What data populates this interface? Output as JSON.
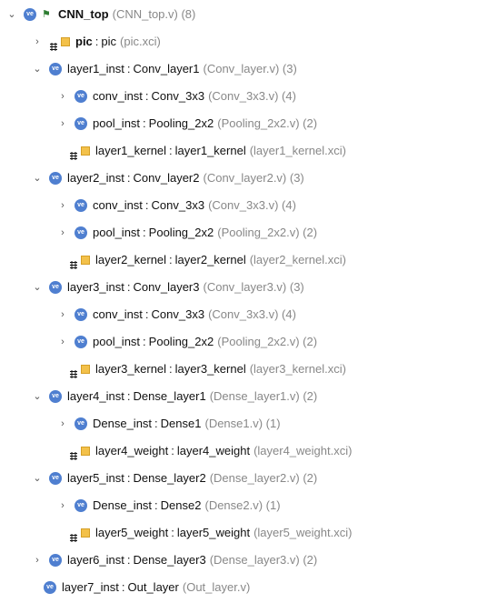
{
  "tree": {
    "rows": [
      {
        "expand": "expanded",
        "icon": "verilog-module-icon",
        "secondary_icon": "hierarchy-icon",
        "instance": "CNN_top",
        "module": "",
        "meta": "(CNN_top.v) (8)"
      },
      {
        "expand": "collapsed",
        "icon": "ip-core-icon",
        "instance": "pic",
        "module": "pic",
        "meta": "(pic.xci)"
      },
      {
        "expand": "expanded",
        "icon": "verilog-module-icon",
        "instance": "layer1_inst",
        "module": "Conv_layer1",
        "meta": "(Conv_layer.v) (3)"
      },
      {
        "expand": "collapsed",
        "icon": "verilog-module-icon",
        "instance": "conv_inst",
        "module": "Conv_3x3",
        "meta": "(Conv_3x3.v) (4)"
      },
      {
        "expand": "collapsed",
        "icon": "verilog-module-icon",
        "instance": "pool_inst",
        "module": "Pooling_2x2",
        "meta": "(Pooling_2x2.v) (2)"
      },
      {
        "expand": "none",
        "icon": "ip-core-icon",
        "instance": "layer1_kernel",
        "module": "layer1_kernel",
        "meta": "(layer1_kernel.xci)"
      },
      {
        "expand": "expanded",
        "icon": "verilog-module-icon",
        "instance": "layer2_inst",
        "module": "Conv_layer2",
        "meta": "(Conv_layer2.v) (3)"
      },
      {
        "expand": "collapsed",
        "icon": "verilog-module-icon",
        "instance": "conv_inst",
        "module": "Conv_3x3",
        "meta": "(Conv_3x3.v) (4)"
      },
      {
        "expand": "collapsed",
        "icon": "verilog-module-icon",
        "instance": "pool_inst",
        "module": "Pooling_2x2",
        "meta": "(Pooling_2x2.v) (2)"
      },
      {
        "expand": "none",
        "icon": "ip-core-icon",
        "instance": "layer2_kernel",
        "module": "layer2_kernel",
        "meta": "(layer2_kernel.xci)"
      },
      {
        "expand": "expanded",
        "icon": "verilog-module-icon",
        "instance": "layer3_inst",
        "module": "Conv_layer3",
        "meta": "(Conv_layer3.v) (3)"
      },
      {
        "expand": "collapsed",
        "icon": "verilog-module-icon",
        "instance": "conv_inst",
        "module": "Conv_3x3",
        "meta": "(Conv_3x3.v) (4)"
      },
      {
        "expand": "collapsed",
        "icon": "verilog-module-icon",
        "instance": "pool_inst",
        "module": "Pooling_2x2",
        "meta": "(Pooling_2x2.v) (2)"
      },
      {
        "expand": "none",
        "icon": "ip-core-icon",
        "instance": "layer3_kernel",
        "module": "layer3_kernel",
        "meta": "(layer3_kernel.xci)"
      },
      {
        "expand": "expanded",
        "icon": "verilog-module-icon",
        "instance": "layer4_inst",
        "module": "Dense_layer1",
        "meta": "(Dense_layer1.v) (2)"
      },
      {
        "expand": "collapsed",
        "icon": "verilog-module-icon",
        "instance": "Dense_inst",
        "module": "Dense1",
        "meta": "(Dense1.v) (1)"
      },
      {
        "expand": "none",
        "icon": "ip-core-icon",
        "instance": "layer4_weight",
        "module": "layer4_weight",
        "meta": "(layer4_weight.xci)"
      },
      {
        "expand": "expanded",
        "icon": "verilog-module-icon",
        "instance": "layer5_inst",
        "module": "Dense_layer2",
        "meta": "(Dense_layer2.v) (2)"
      },
      {
        "expand": "collapsed",
        "icon": "verilog-module-icon",
        "instance": "Dense_inst",
        "module": "Dense2",
        "meta": "(Dense2.v) (1)"
      },
      {
        "expand": "none",
        "icon": "ip-core-icon",
        "instance": "layer5_weight",
        "module": "layer5_weight",
        "meta": "(layer5_weight.xci)"
      },
      {
        "expand": "collapsed",
        "icon": "verilog-module-icon",
        "instance": "layer6_inst",
        "module": "Dense_layer3",
        "meta": "(Dense_layer3.v) (2)"
      },
      {
        "expand": "none",
        "icon": "verilog-module-icon",
        "instance": "layer7_inst",
        "module": "Out_layer",
        "meta": "(Out_layer.v)"
      }
    ]
  },
  "colors": {
    "meta": "#888888",
    "text": "#111111",
    "verilog_icon": "#4f7fd0",
    "ip_icon": "#f3c14a",
    "hierarchy_icon": "#2e7d32"
  }
}
